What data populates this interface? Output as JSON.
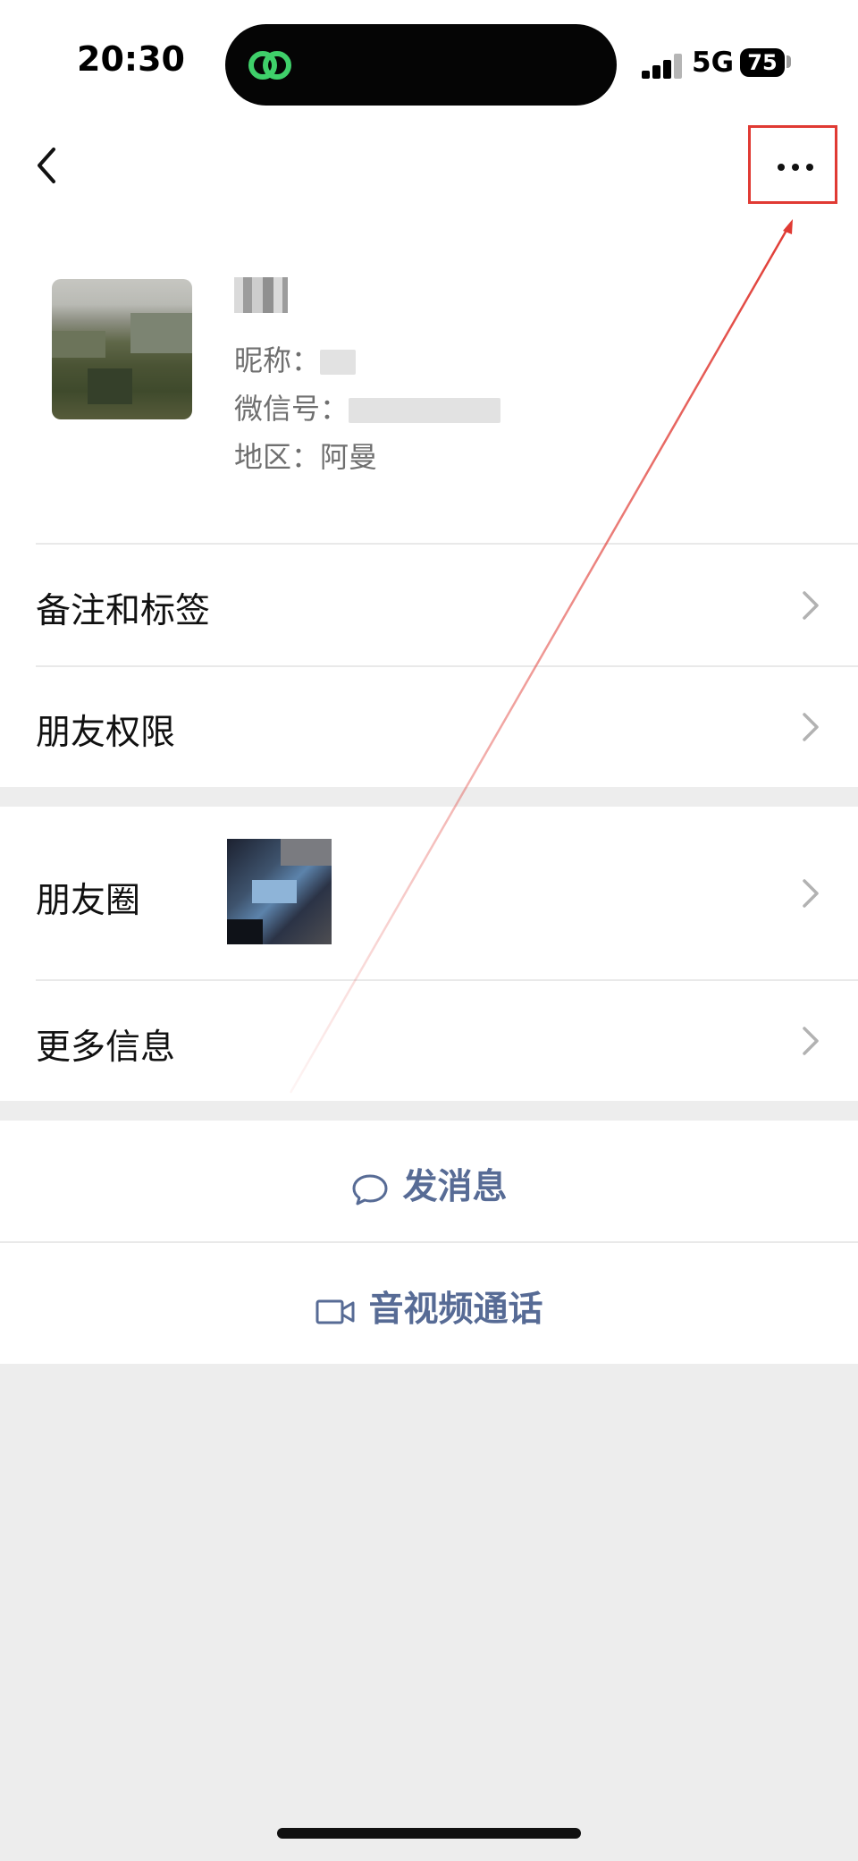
{
  "status_bar": {
    "time": "20:30",
    "network": "5G",
    "battery": "75"
  },
  "nav": {
    "back_icon": "chevron-left-icon",
    "more_icon": "ellipsis-icon"
  },
  "profile": {
    "nickname_label": "昵称：",
    "wechat_id_label": "微信号：",
    "region_label": "地区：",
    "region_value": "阿曼"
  },
  "menu": {
    "remark_tags": "备注和标签",
    "friend_permissions": "朋友权限",
    "moments": "朋友圈",
    "more_info": "更多信息"
  },
  "actions": {
    "send_message": "发消息",
    "video_call": "音视频通话"
  },
  "colors": {
    "accent": "#576b95",
    "annotation": "#e03a33",
    "background": "#ededed"
  }
}
